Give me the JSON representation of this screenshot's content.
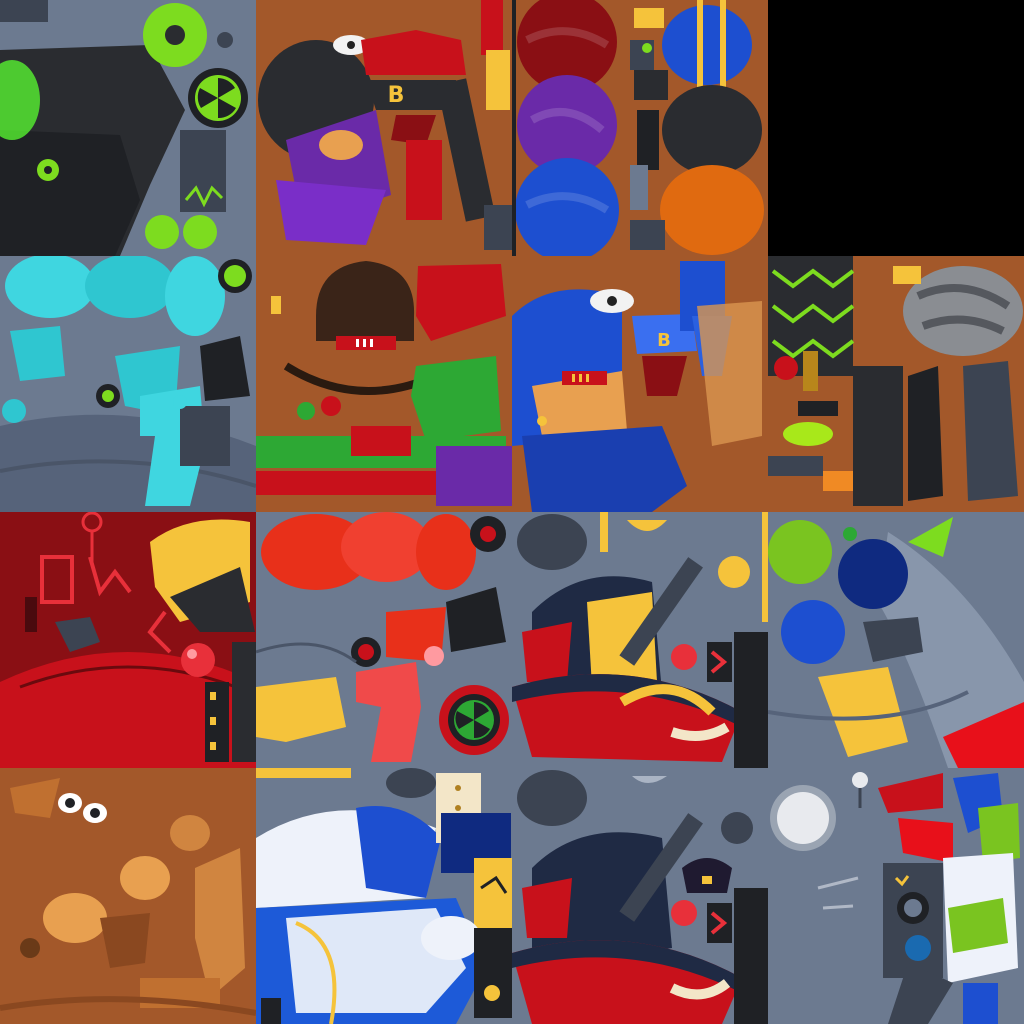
{
  "tiles": {
    "bomb_badge_letter": "B",
    "helmet_badge_letter": "B"
  },
  "colors": {
    "slate": "#6c7a90",
    "dark_slate": "#3c4452",
    "brown": "#a3582a",
    "radioactive_green": "#7ddc1f",
    "red": "#c8111b",
    "blue": "#1d4fd0",
    "purple": "#6a2aa8",
    "yellow": "#f5c33b",
    "cyan": "#3fd6e0"
  }
}
